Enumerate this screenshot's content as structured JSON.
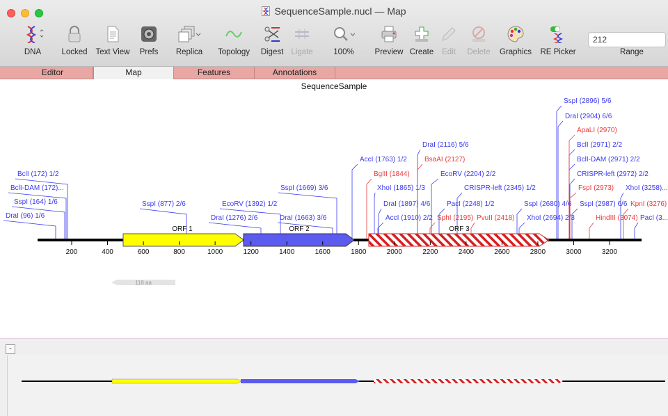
{
  "window": {
    "title": "SequenceSample.nucl — Map"
  },
  "toolbar": {
    "items": [
      {
        "label": "DNA",
        "icon": "dna-helix-icon"
      },
      {
        "label": "Locked",
        "icon": "lock-icon"
      },
      {
        "label": "Text View",
        "icon": "document-icon"
      },
      {
        "label": "Prefs",
        "icon": "gear-icon"
      },
      {
        "label": "Replica",
        "icon": "stacked-pages-icon"
      },
      {
        "label": "Topology",
        "icon": "wave-icon"
      },
      {
        "label": "Digest",
        "icon": "scissors-icon"
      },
      {
        "label": "Ligate",
        "icon": "ligate-icon"
      },
      {
        "label": "100%",
        "icon": "zoom-icon"
      },
      {
        "label": "Preview",
        "icon": "printer-icon"
      },
      {
        "label": "Create",
        "icon": "create-icon"
      },
      {
        "label": "Edit",
        "icon": "pencil-icon"
      },
      {
        "label": "Delete",
        "icon": "delete-icon"
      },
      {
        "label": "Graphics",
        "icon": "palette-icon"
      },
      {
        "label": "RE Picker",
        "icon": "re-picker-icon"
      }
    ],
    "range_value": "212",
    "range_label": "Range"
  },
  "tabs": [
    "Editor",
    "Map",
    "Features",
    "Annotations"
  ],
  "active_tab": "Map",
  "map": {
    "title": "SequenceSample",
    "axis_ticks": [
      "200",
      "400",
      "600",
      "800",
      "1000",
      "1200",
      "1400",
      "1600",
      "1800",
      "2000",
      "2200",
      "2400",
      "2600",
      "2800",
      "3000",
      "3200"
    ],
    "orfs": [
      {
        "label": "ORF 1",
        "color": "#ffff00"
      },
      {
        "label": "ORF 2",
        "color": "#5b5bf0"
      },
      {
        "label": "ORF 3",
        "color": "#d62020"
      }
    ],
    "translation_label": "118 aa",
    "sites_blue": [
      "DraI (96) 1/6",
      "SspI (164) 1/6",
      "BclI-DAM (172)...",
      "BclI (172) 1/2",
      "SspI (877) 2/6",
      "DraI (1276) 2/6",
      "EcoRV (1392) 1/2",
      "DraI (1663) 3/6",
      "SspI (1669) 3/6",
      "AccI (1763) 1/2",
      "AccI (1910) 2/2",
      "DraI (1897) 4/6",
      "XhoI (1865) 1/3",
      "DraI (2116) 5/6",
      "EcoRV (2204) 2/2",
      "PacI (2248) 1/2",
      "CRISPR-left (2345) 1/2",
      "SspI (2680) 4/6",
      "XhoI (2694) 2/3",
      "SspI (2896) 5/6",
      "DraI (2904) 6/6",
      "BclI (2971) 2/2",
      "BclI-DAM (2971) 2/2",
      "CRISPR-left (2972) 2/2",
      "SspI (2987) 6/6",
      "XhoI (3258)...",
      "PacI (3..."
    ],
    "sites_red": [
      "BglII (1844)",
      "BsaAI (2127)",
      "SphI (2195)",
      "PvuII (2418)",
      "ApaLI (2970)",
      "FspI (2973)",
      "HindIII (3074)",
      "KpnI (3276)"
    ]
  },
  "overview": {
    "collapse_label": "-"
  },
  "colors": {
    "blue_site": "#3a3aee",
    "red_site": "#e83a3a",
    "tab_bar": "#e8a7a3"
  }
}
